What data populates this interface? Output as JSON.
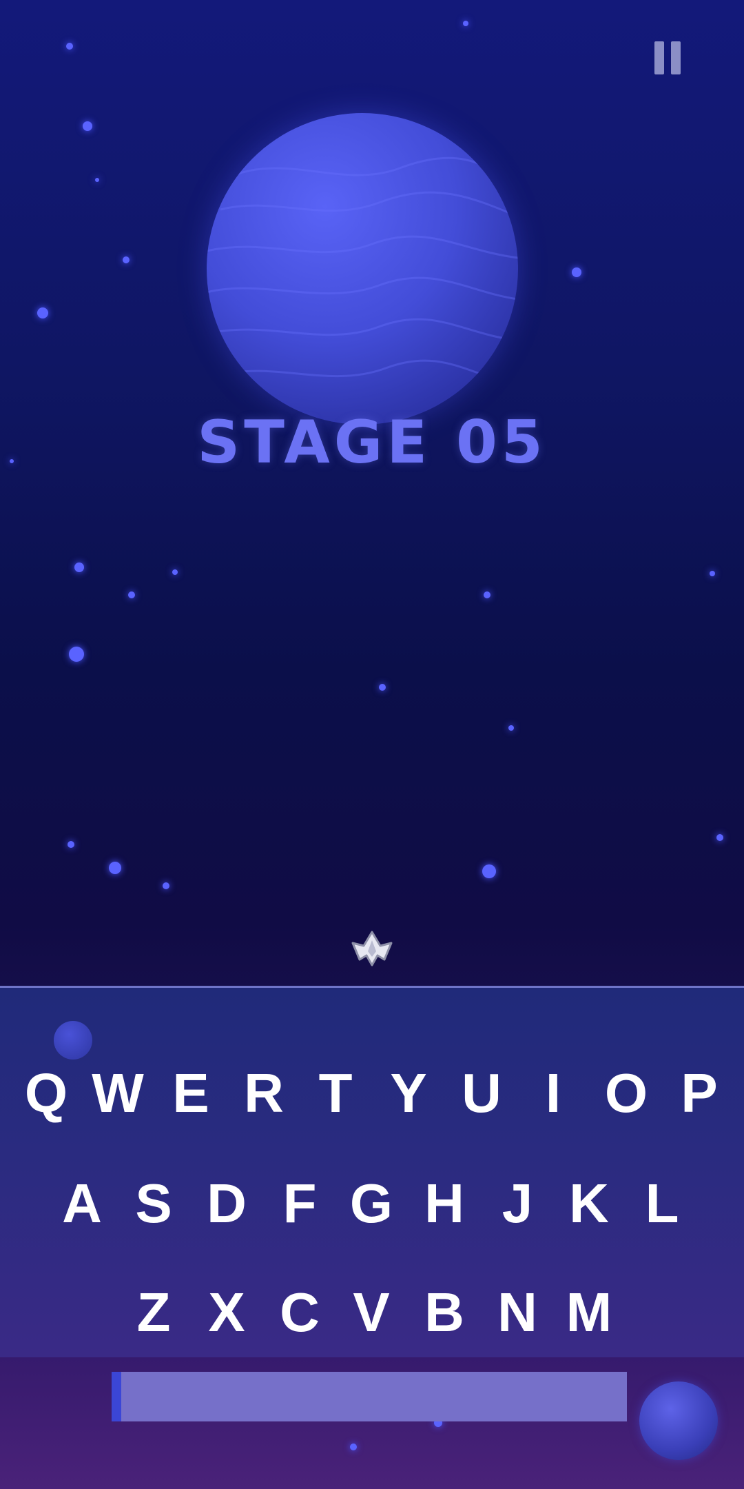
{
  "hud": {
    "stage_title": "STAGE 05",
    "pause_icon": "pause-icon"
  },
  "player": {
    "icon": "spaceship-icon"
  },
  "keyboard": {
    "rows": [
      [
        "Q",
        "W",
        "E",
        "R",
        "T",
        "Y",
        "U",
        "I",
        "O",
        "P"
      ],
      [
        "A",
        "S",
        "D",
        "F",
        "G",
        "H",
        "J",
        "K",
        "L"
      ],
      [
        "Z",
        "X",
        "C",
        "V",
        "B",
        "N",
        "M"
      ]
    ]
  },
  "input": {
    "value": ""
  },
  "colors": {
    "title": "#6b72f4",
    "input_bg": "#7670c9",
    "input_accent": "#3b46d6",
    "keyboard_top": "#202a7a",
    "keyboard_bottom": "#3a2a86",
    "star": "#5a63ff"
  }
}
